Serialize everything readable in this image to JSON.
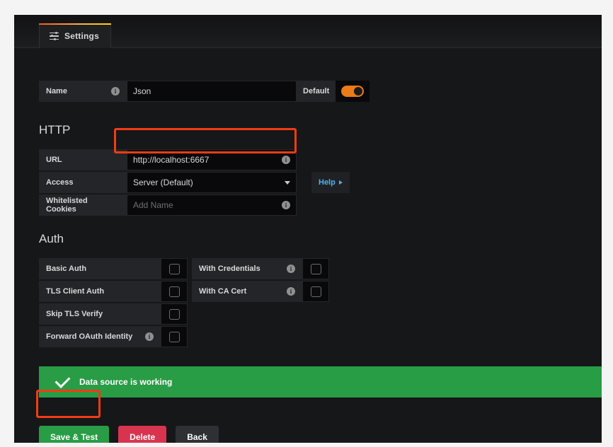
{
  "tabs": [
    {
      "label": "Settings",
      "icon": "sliders-icon"
    }
  ],
  "name_field": {
    "label": "Name",
    "value": "Json",
    "info_glyph": "i",
    "default_label": "Default",
    "default_toggle_on": true
  },
  "http": {
    "title": "HTTP",
    "rows": [
      {
        "label": "URL",
        "value": "http://localhost:6667",
        "placeholder": "",
        "info": true
      },
      {
        "label": "Access",
        "value": "Server (Default)",
        "placeholder": "",
        "info": false
      },
      {
        "label": "Whitelisted Cookies",
        "value": "",
        "placeholder": "Add Name",
        "info": true
      }
    ],
    "help_label": "Help"
  },
  "auth": {
    "title": "Auth",
    "left_items": [
      {
        "label": "Basic Auth",
        "info": false,
        "checked": false
      },
      {
        "label": "TLS Client Auth",
        "info": false,
        "checked": false
      },
      {
        "label": "Skip TLS Verify",
        "info": false,
        "checked": false
      },
      {
        "label": "Forward OAuth Identity",
        "info": true,
        "checked": false
      }
    ],
    "right_items": [
      {
        "label": "With Credentials",
        "info": true,
        "checked": false
      },
      {
        "label": "With CA Cert",
        "info": true,
        "checked": false
      }
    ]
  },
  "status": {
    "message": "Data source is working",
    "icon": "check-icon",
    "color": "#299c46"
  },
  "actions": {
    "save_label": "Save & Test",
    "delete_label": "Delete",
    "back_label": "Back"
  },
  "annotations": {
    "highlight_color": "#f23c14",
    "targets": [
      "url-input",
      "save-button"
    ]
  }
}
